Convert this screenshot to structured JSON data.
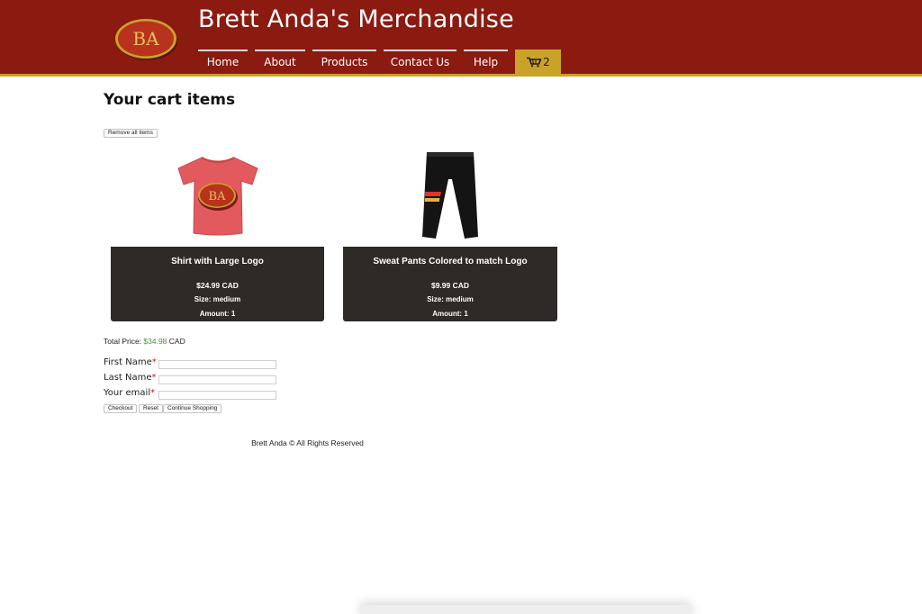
{
  "header": {
    "title": "Brett Anda's Merchandise",
    "logo_text": "BA"
  },
  "nav": {
    "items": [
      {
        "label": "Home"
      },
      {
        "label": "About"
      },
      {
        "label": "Products"
      },
      {
        "label": "Contact Us"
      },
      {
        "label": "Help"
      }
    ],
    "cart_count": "2"
  },
  "main": {
    "heading": "Your cart items",
    "remove_all_label": "Remove all items",
    "items": [
      {
        "name": "Shirt with Large Logo",
        "price": "$24.99 CAD",
        "size": "Size: medium",
        "amount": "Amount: 1",
        "image_logo": "BA"
      },
      {
        "name": "Sweat Pants Colored to match Logo",
        "price": "$9.99 CAD",
        "size": "Size: medium",
        "amount": "Amount: 1"
      }
    ],
    "total_label": "Total Price: ",
    "total_value": "$34.98",
    "total_currency": " CAD"
  },
  "form": {
    "first_name_label": "First Name",
    "last_name_label": "Last Name",
    "email_label": "Your email",
    "required_mark": "*",
    "checkout_label": "Checkout",
    "reset_label": "Reset",
    "continue_label": "Continue Shopping"
  },
  "footer": {
    "text": "Brett Anda © All Rights Reserved"
  },
  "colors": {
    "header_red": "#8b1a10",
    "accent_gold": "#c9a227",
    "card_dark": "#2e2a26",
    "price_green": "#3c9a3c",
    "required_red": "#c01f1f"
  }
}
